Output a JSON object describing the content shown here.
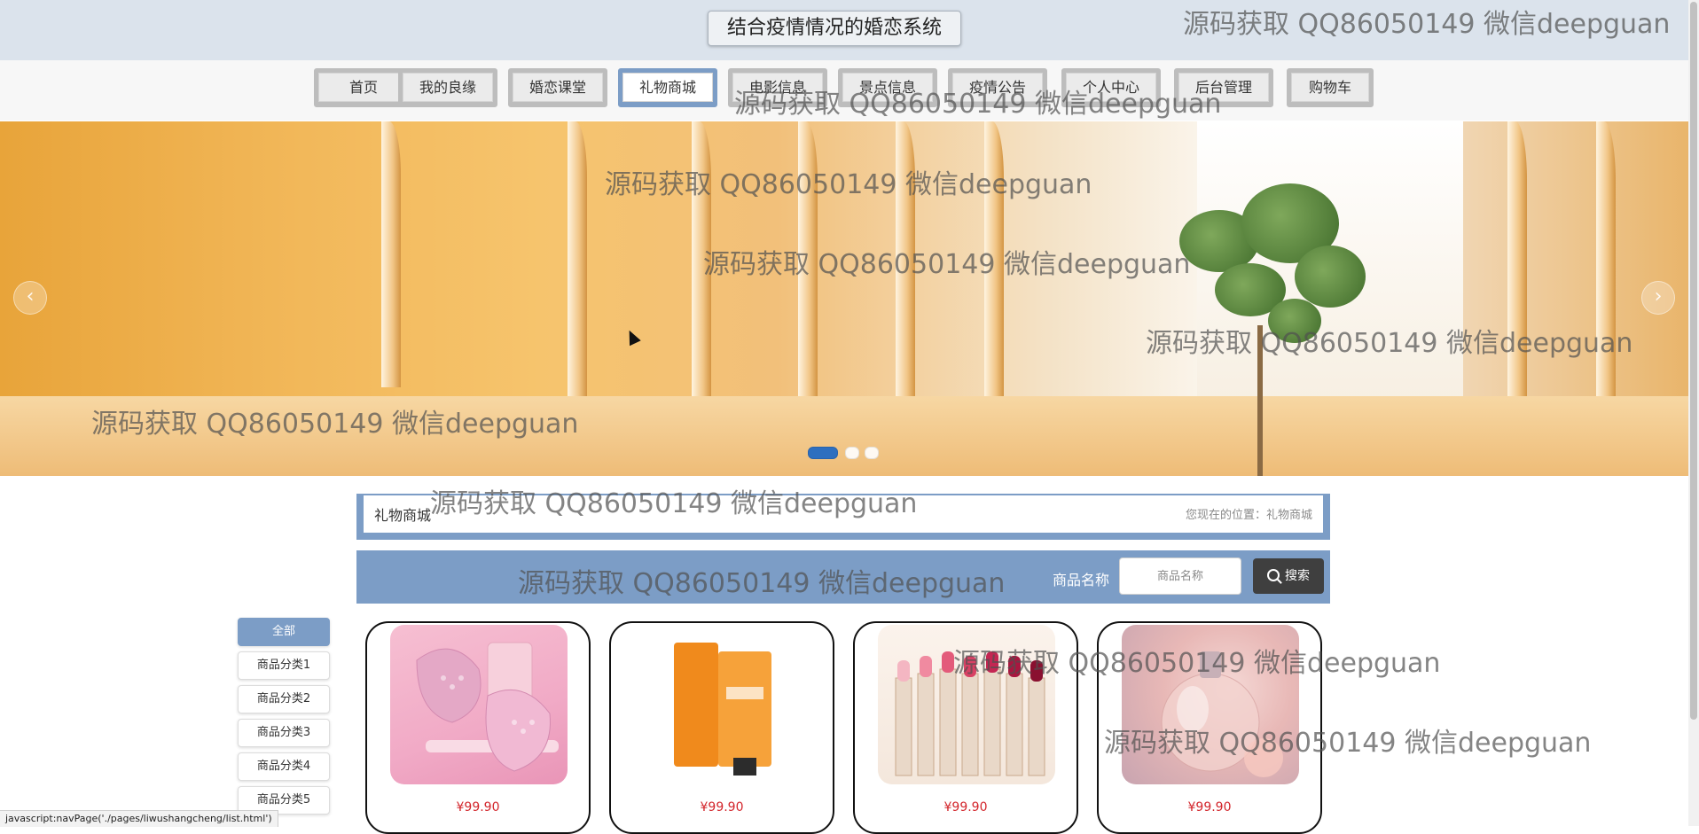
{
  "header": {
    "title": "结合疫情情况的婚恋系统"
  },
  "nav": {
    "items": [
      {
        "label": "首页",
        "active": false
      },
      {
        "label": "我的良缘",
        "active": false
      },
      {
        "label": "婚恋课堂",
        "active": false
      },
      {
        "label": "礼物商城",
        "active": true
      },
      {
        "label": "电影信息",
        "active": false
      },
      {
        "label": "景点信息",
        "active": false
      },
      {
        "label": "疫情公告",
        "active": false
      },
      {
        "label": "个人中心",
        "active": false
      },
      {
        "label": "后台管理",
        "active": false
      },
      {
        "label": "购物车",
        "active": false
      }
    ]
  },
  "banner": {
    "prev_label": "‹",
    "next_label": "›",
    "slide_count": 3,
    "active_slide": 1
  },
  "location": {
    "title": "礼物商城",
    "path": "您现在的位置：礼物商城"
  },
  "search": {
    "label": "商品名称",
    "placeholder": "商品名称",
    "button_label": "搜索"
  },
  "categories": [
    {
      "label": "全部",
      "active": true
    },
    {
      "label": "商品分类1",
      "active": false
    },
    {
      "label": "商品分类2",
      "active": false
    },
    {
      "label": "商品分类3",
      "active": false
    },
    {
      "label": "商品分类4",
      "active": false
    },
    {
      "label": "商品分类5",
      "active": false
    }
  ],
  "products": [
    {
      "price": "¥99.90",
      "image": "facial-cleanser-device"
    },
    {
      "price": "¥99.90",
      "image": "sunscreen-tube"
    },
    {
      "price": "¥99.90",
      "image": "lipstick-set"
    },
    {
      "price": "¥99.90",
      "image": "perfume-bottle"
    }
  ],
  "watermark": "源码获取 QQ86050149 微信deepguan",
  "status_link": "javascript:navPage('./pages/liwushangcheng/list.html')",
  "colors": {
    "accent": "#7c9dc6",
    "header_bg": "#dbe3ec",
    "price": "#d3262c",
    "search_button": "#3f3f3f"
  }
}
